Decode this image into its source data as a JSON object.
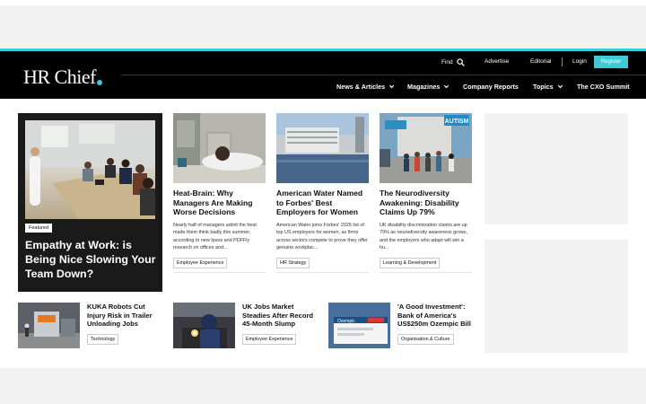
{
  "header": {
    "logo": "HR Chief",
    "util": {
      "find": "Find",
      "advertise": "Advertise",
      "editorial": "Editorial",
      "login": "Login",
      "register": "Register"
    },
    "nav": {
      "news": "News & Articles",
      "magazines": "Magazines",
      "company": "Company Reports",
      "topics": "Topics",
      "cxo": "The CXO Summit"
    }
  },
  "feature": {
    "badge": "Featured",
    "title": "Empathy at Work: is Being Nice Slowing Your Team Down?"
  },
  "cards": [
    {
      "title": "Heat-Brain: Why Managers Are Making Worse Decisions",
      "desc": "Nearly half of managers admit the heat made them think badly this summer, according to new Ipsos and PDFFly research on offices and...",
      "tag": "Employee Experience"
    },
    {
      "title": "American Water Named to Forbes' Best Employers for Women",
      "desc": "American Water joins Forbes' 2026 list of top US employers for women, as firms across sectors compete to prove they offer genuine workplac...",
      "tag": "HR Strategy"
    },
    {
      "title": "The Neurodiversity Awakening: Disability Claims Up 79%",
      "desc": "UK disability discrimination claims are up 79% as neurodiversity awareness grows, and the employers who adapt will win a hu...",
      "tag": "Learning & Development"
    }
  ],
  "small": [
    {
      "title": "KUKA Robots Cut Injury Risk in Trailer Unloading Jobs",
      "tag": "Technology"
    },
    {
      "title": "UK Jobs Market Steadies After Record 45-Month Slump",
      "tag": "Employee Experience"
    },
    {
      "title": "'A Good Investment': Bank of America's US$250m Ozempic Bill",
      "tag": "Organisation & Culture"
    }
  ],
  "images": {
    "autism_sign": "AUTISM",
    "ozempic_box": "Ozempic"
  },
  "colors": {
    "accent": "#3ec9d6",
    "header_bg": "#000000",
    "feature_bg": "#1a1a1a"
  }
}
